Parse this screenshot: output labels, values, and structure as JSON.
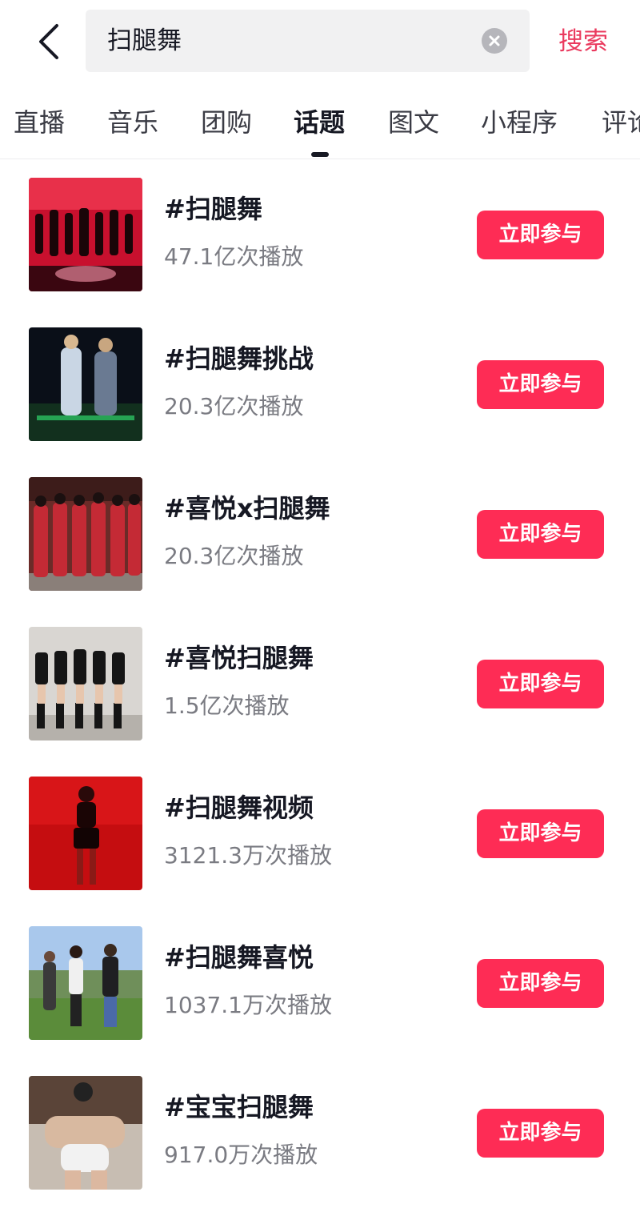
{
  "search": {
    "query": "扫腿舞",
    "action_label": "搜索"
  },
  "tabs": [
    {
      "label": "直播"
    },
    {
      "label": "音乐"
    },
    {
      "label": "团购"
    },
    {
      "label": "话题"
    },
    {
      "label": "图文"
    },
    {
      "label": "小程序"
    },
    {
      "label": "评论"
    }
  ],
  "active_tab": "话题",
  "topics": [
    {
      "title": "#扫腿舞",
      "plays": "47.1亿次播放",
      "button": "立即参与"
    },
    {
      "title": "#扫腿舞挑战",
      "plays": "20.3亿次播放",
      "button": "立即参与"
    },
    {
      "title": "#喜悦x扫腿舞",
      "plays": "20.3亿次播放",
      "button": "立即参与"
    },
    {
      "title": "#喜悦扫腿舞",
      "plays": "1.5亿次播放",
      "button": "立即参与"
    },
    {
      "title": "#扫腿舞视频",
      "plays": "3121.3万次播放",
      "button": "立即参与"
    },
    {
      "title": "#扫腿舞喜悦",
      "plays": "1037.1万次播放",
      "button": "立即参与"
    },
    {
      "title": "#宝宝扫腿舞",
      "plays": "917.0万次播放",
      "button": "立即参与"
    }
  ],
  "colors": {
    "accent": "#fe2c55",
    "search_action": "#ea3a5e",
    "text_primary": "#161823",
    "text_secondary": "#7a7b82"
  },
  "icons": {
    "back": "chevron-left-icon",
    "clear": "clear-icon"
  }
}
